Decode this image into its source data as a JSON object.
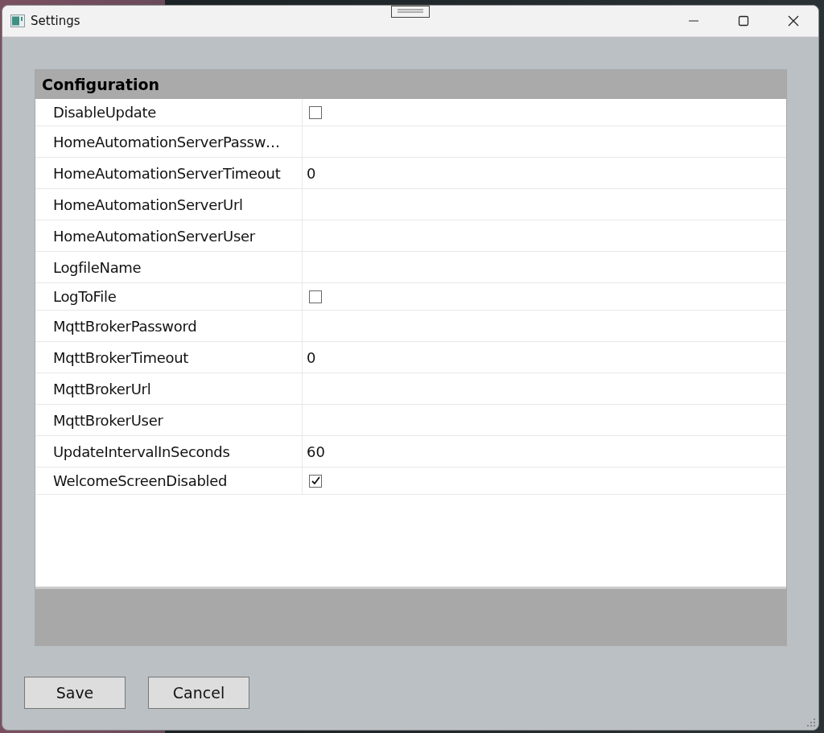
{
  "window": {
    "title": "Settings"
  },
  "property_grid": {
    "category": "Configuration",
    "properties": [
      {
        "name": "DisableUpdate",
        "kind": "checkbox",
        "checked": false
      },
      {
        "name": "HomeAutomationServerPassw…",
        "kind": "text"
      },
      {
        "name": "HomeAutomationServerTimeout",
        "kind": "text",
        "value": "0"
      },
      {
        "name": "HomeAutomationServerUrl",
        "kind": "text"
      },
      {
        "name": "HomeAutomationServerUser",
        "kind": "text"
      },
      {
        "name": "LogfileName",
        "kind": "text"
      },
      {
        "name": "LogToFile",
        "kind": "checkbox",
        "checked": false
      },
      {
        "name": "MqttBrokerPassword",
        "kind": "text"
      },
      {
        "name": "MqttBrokerTimeout",
        "kind": "text",
        "value": "0"
      },
      {
        "name": "MqttBrokerUrl",
        "kind": "text"
      },
      {
        "name": "MqttBrokerUser",
        "kind": "text"
      },
      {
        "name": "UpdateIntervalInSeconds",
        "kind": "text",
        "value": "60"
      },
      {
        "name": "WelcomeScreenDisabled",
        "kind": "checkbox",
        "checked": true
      }
    ]
  },
  "buttons": [
    "Save",
    "Cancel"
  ]
}
